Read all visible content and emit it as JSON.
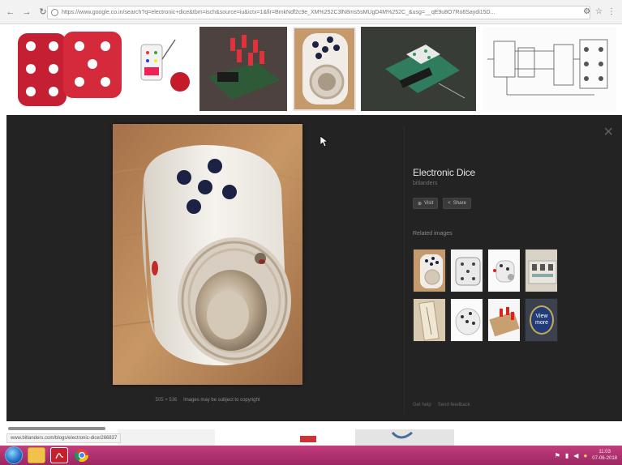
{
  "browser": {
    "url": "https://www.google.co.in/search?q=electronic+dice&tbm=isch&source=iu&ictx=1&fir=BmkNdf2c9e_XM%252C3lN8ms5sMUgD4M%252C_&usg=__qE9u8O7Ro8Saydi15D..."
  },
  "detail": {
    "title": "Electronic Dice",
    "source": "bitlanders",
    "visit_label": "Visit",
    "share_label": "Share",
    "related_label": "Related images",
    "view_more_label": "View more",
    "image_size": "505 × 536",
    "copyright_note": "Images may be subject to copyright",
    "footer_links": [
      "Get help",
      "Send feedback"
    ],
    "close_label": "✕"
  },
  "status": {
    "hover_url": "www.bitlanders.com/blogs/electronic-dice/266837"
  },
  "taskbar": {
    "time": "11:03",
    "date": "07-06-2018"
  },
  "colors": {
    "panel_bg": "#232323",
    "taskbar": "#b3306f",
    "dice_red": "#c51f33"
  },
  "icons": [
    "back-icon",
    "forward-icon",
    "reload-icon",
    "lock-icon",
    "star-icon",
    "close-icon",
    "visit-icon",
    "share-icon"
  ]
}
